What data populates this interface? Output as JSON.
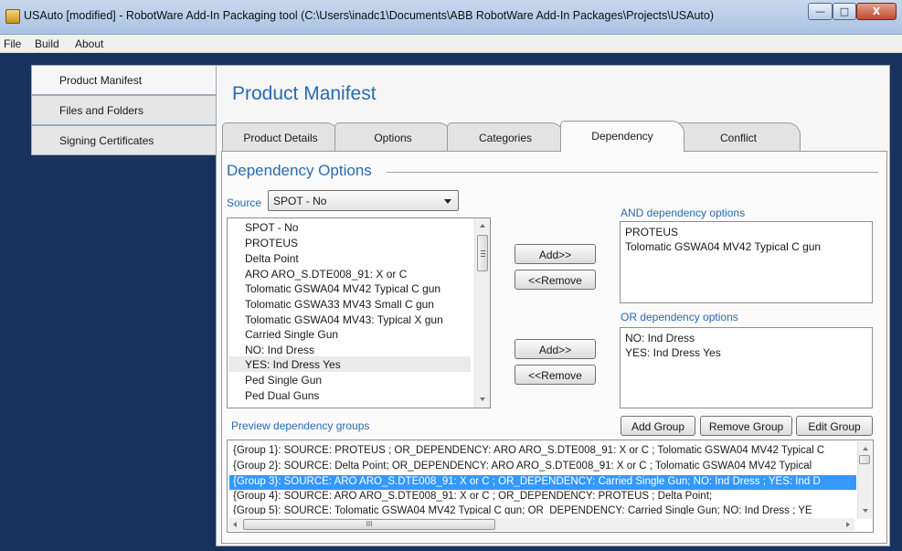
{
  "window": {
    "title": "USAuto [modified] - RobotWare Add-In Packaging tool (C:\\Users\\inadc1\\Documents\\ABB RobotWare Add-In Packages\\Projects\\USAuto)",
    "minimize": "—",
    "maximize": "□",
    "close": "X"
  },
  "menu": [
    "File",
    "Build",
    "About"
  ],
  "nav": [
    "Product Manifest",
    "Files and Folders",
    "Signing Certificates"
  ],
  "page_title": "Product Manifest",
  "tabs": [
    "Product Details",
    "Options",
    "Categories",
    "Dependency",
    "Conflict"
  ],
  "active_tab": "Dependency",
  "section_title": "Dependency Options",
  "source": {
    "label": "Source",
    "selected": "SPOT - No"
  },
  "source_list": [
    "SPOT - No",
    "PROTEUS",
    "Delta Point",
    "ARO  ARO_S.DTE008_91:  X or C",
    "Tolomatic GSWA04 MV42 Typical C gun",
    "Tolomatic GSWA33 MV43 Small C gun",
    "Tolomatic GSWA04 MV43: Typical X gun",
    "Carried Single Gun",
    "NO:  Ind Dress",
    "YES:  Ind Dress Yes",
    "Ped Single Gun",
    "Ped Dual Guns"
  ],
  "buttons": {
    "add": "Add>>",
    "remove": "<<Remove",
    "add_group": "Add Group",
    "remove_group": "Remove Group",
    "edit_group": "Edit Group"
  },
  "and_dependency": {
    "label": "AND dependency options",
    "items": [
      "PROTEUS",
      "Tolomatic GSWA04 MV42 Typical C gun"
    ]
  },
  "or_dependency": {
    "label": "OR dependency options",
    "items": [
      "NO:  Ind Dress",
      "YES:  Ind Dress Yes"
    ]
  },
  "preview": {
    "label": "Preview dependency groups",
    "rows": [
      "{Group 1}: SOURCE: PROTEUS ; OR_DEPENDENCY: ARO  ARO_S.DTE008_91:  X or C ; Tolomatic GSWA04 MV42 Typical C",
      "{Group 2}: SOURCE: Delta Point; OR_DEPENDENCY: ARO  ARO_S.DTE008_91:  X or C ; Tolomatic GSWA04 MV42 Typical",
      "{Group 3}: SOURCE: ARO  ARO_S.DTE008_91:  X or C ; OR_DEPENDENCY: Carried Single Gun; NO:  Ind Dress ; YES:  Ind D",
      "{Group 4}: SOURCE: ARO  ARO_S.DTE008_91:  X or C ; OR_DEPENDENCY: PROTEUS ; Delta Point;",
      "{Group 5}: SOURCE: Tolomatic GSWA04 MV42 Typical C gun; OR_DEPENDENCY: Carried Single Gun; NO:  Ind Dress ; YE"
    ],
    "selected_index": 2,
    "hscroll_grip": "III"
  },
  "colors": {
    "accent": "#2a6ab3",
    "app_background": "#17325f",
    "selection": "#3399ff"
  }
}
